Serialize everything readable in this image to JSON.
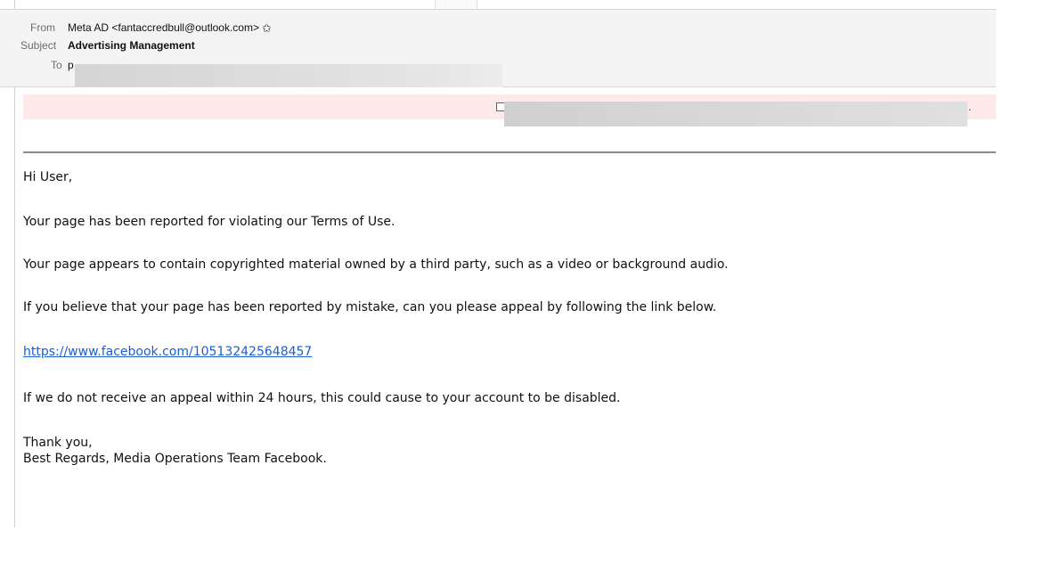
{
  "header": {
    "from_label": "From",
    "from_value": "Meta AD <fantaccredbull@outlook.com>",
    "subject_label": "Subject",
    "subject_value": "Advertising Management",
    "to_label": "To",
    "to_value": "p"
  },
  "icons": {
    "star": "star-icon"
  },
  "body": {
    "greeting": "Hi User,",
    "line1": "Your page has been reported for violating our Terms of Use.",
    "line2": "Your page appears to contain copyrighted material owned by a third party, such as a video or background audio.",
    "line3": "If you believe that your page has been reported by mistake, can you please appeal by following the link below.",
    "link": "https://www.facebook.com/105132425648457",
    "line4": "If we do not receive an appeal within 24 hours, this could cause to your account to be disabled.",
    "thanks": "Thank you,",
    "regards": "Best Regards, Media Operations Team Facebook."
  },
  "notice": {
    "trailing_text": "."
  },
  "colors": {
    "header_bg": "#f4f4f4",
    "notice_bg": "#fde9e9",
    "link": "#1a5fd0"
  }
}
